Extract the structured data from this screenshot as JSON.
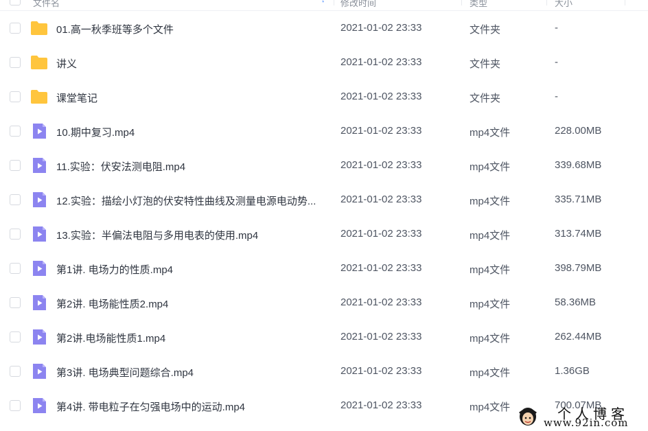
{
  "header": {
    "name_label": "文件名",
    "time_label": "修改时间",
    "type_label": "类型",
    "size_label": "大小"
  },
  "files": [
    {
      "kind": "folder",
      "name": "01.高一秋季班等多个文件",
      "time": "2021-01-02 23:33",
      "type": "文件夹",
      "size": "-"
    },
    {
      "kind": "folder",
      "name": "讲义",
      "time": "2021-01-02 23:33",
      "type": "文件夹",
      "size": "-"
    },
    {
      "kind": "folder",
      "name": "课堂笔记",
      "time": "2021-01-02 23:33",
      "type": "文件夹",
      "size": "-"
    },
    {
      "kind": "video",
      "name": "10.期中复习.mp4",
      "time": "2021-01-02 23:33",
      "type": "mp4文件",
      "size": "228.00MB"
    },
    {
      "kind": "video",
      "name": "11.实验：伏安法测电阻.mp4",
      "time": "2021-01-02 23:33",
      "type": "mp4文件",
      "size": "339.68MB"
    },
    {
      "kind": "video",
      "name": "12.实验：描绘小灯泡的伏安特性曲线及测量电源电动势...",
      "time": "2021-01-02 23:33",
      "type": "mp4文件",
      "size": "335.71MB"
    },
    {
      "kind": "video",
      "name": "13.实验：半偏法电阻与多用电表的使用.mp4",
      "time": "2021-01-02 23:33",
      "type": "mp4文件",
      "size": "313.74MB"
    },
    {
      "kind": "video",
      "name": "第1讲. 电场力的性质.mp4",
      "time": "2021-01-02 23:33",
      "type": "mp4文件",
      "size": "398.79MB"
    },
    {
      "kind": "video",
      "name": "第2讲. 电场能性质2.mp4",
      "time": "2021-01-02 23:33",
      "type": "mp4文件",
      "size": "58.36MB"
    },
    {
      "kind": "video",
      "name": "第2讲.电场能性质1.mp4",
      "time": "2021-01-02 23:33",
      "type": "mp4文件",
      "size": "262.44MB"
    },
    {
      "kind": "video",
      "name": "第3讲. 电场典型问题综合.mp4",
      "time": "2021-01-02 23:33",
      "type": "mp4文件",
      "size": "1.36GB"
    },
    {
      "kind": "video",
      "name": "第4讲. 带电粒子在匀强电场中的运动.mp4",
      "time": "2021-01-02 23:33",
      "type": "mp4文件",
      "size": "700.07MB"
    }
  ],
  "icons": {
    "folder": "folder-icon",
    "video": "video-file-icon"
  },
  "colors": {
    "folder": "#ffc53d",
    "video": "#8c84f0",
    "sort_arrow": "#3b84ff"
  },
  "watermark": {
    "title": "个人博客",
    "url": "www.92in.com"
  }
}
